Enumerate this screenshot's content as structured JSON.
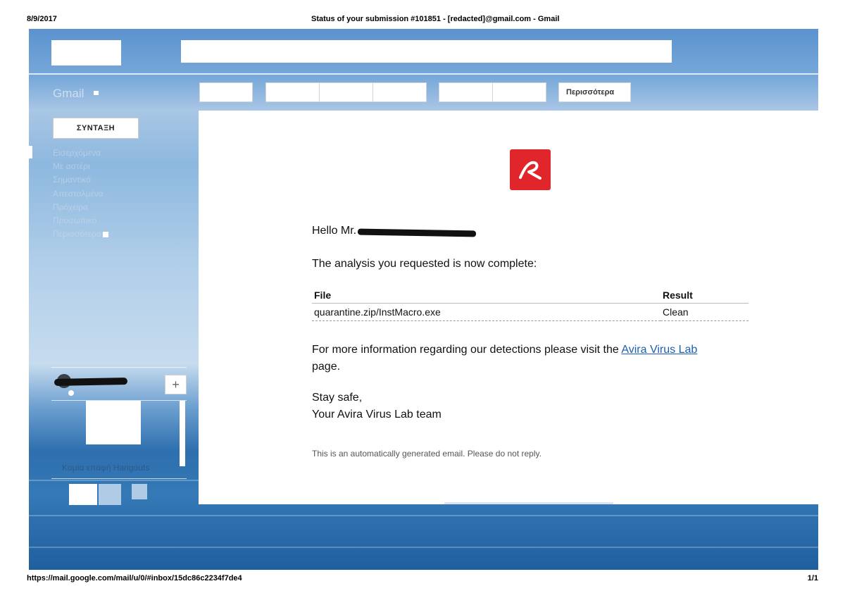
{
  "print_header": {
    "date": "8/9/2017",
    "title": "Status of your submission #101851 - [redacted]@gmail.com - Gmail"
  },
  "print_footer": {
    "url": "https://mail.google.com/mail/u/0/#inbox/15dc86c2234f7de4",
    "page": "1/1"
  },
  "gmail": {
    "app_label": "Gmail",
    "toolbar": {
      "more_label": "Περισσότερα"
    },
    "compose_label": "ΣΥΝΤΑΞΗ",
    "nav_items": [
      "Εισερχόμενα",
      "Με αστέρι",
      "Σημαντικά",
      "Απεσταλμένα",
      "Πρόχειρα",
      "Προσωπικό",
      "Περισσότερα"
    ],
    "hangouts": {
      "plus_label": "+",
      "no_contacts": "Καμία επαφή Hangouts"
    }
  },
  "email": {
    "greeting": "Hello Mr.",
    "analysis_line": "The analysis you requested is now complete:",
    "table": {
      "headers": [
        "File",
        "Result"
      ],
      "rows": [
        {
          "file": "quarantine.zip/InstMacro.exe",
          "result": "Clean"
        }
      ]
    },
    "info_text": "For more information regarding our detections please visit the",
    "info_link": "Avira Virus Lab",
    "info_suffix": "page.",
    "sign_off_1": "Stay safe,",
    "sign_off_2": "Your Avira Virus Lab team",
    "auto_note": "This is an automatically generated email. Please do not reply."
  },
  "colors": {
    "avira_red": "#e0252b",
    "link_blue": "#1a5fb4"
  },
  "icons": {
    "avira_logo": "avira-logo-icon"
  }
}
